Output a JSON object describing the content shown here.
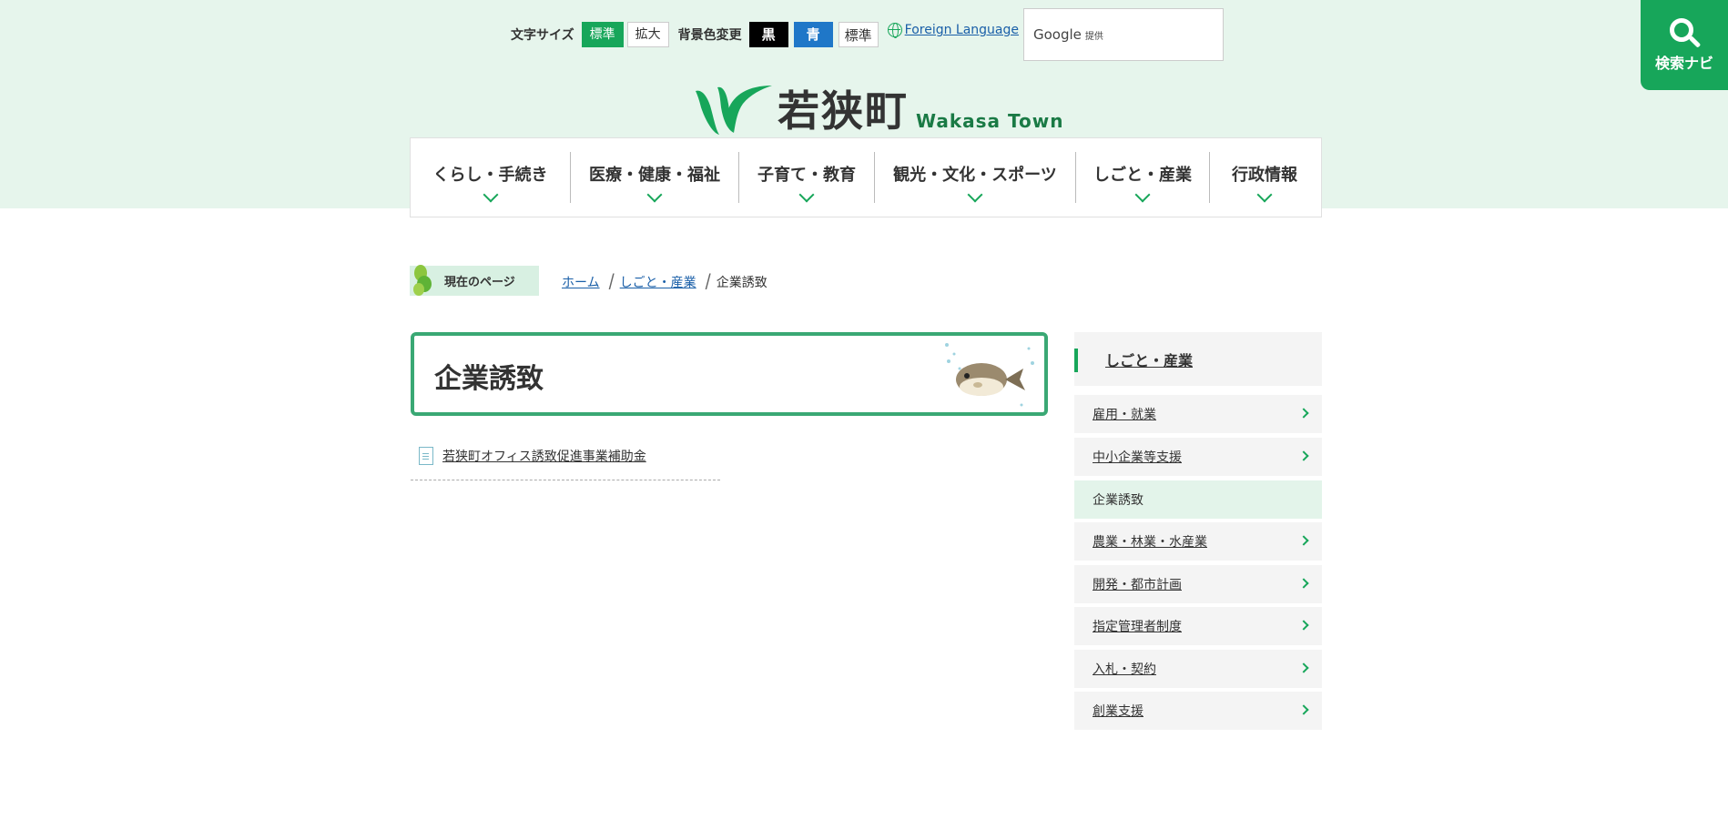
{
  "util": {
    "font_size_label": "文字サイズ",
    "font_size_standard": "標準",
    "font_size_large": "拡大",
    "bg_label": "背景色変更",
    "bg_black": "黒",
    "bg_blue": "青",
    "bg_standard": "標準",
    "foreign_language": "Foreign Language"
  },
  "search": {
    "google_label": "Google",
    "provided": "提供"
  },
  "search_navi": {
    "label": "検索ナビ"
  },
  "logo": {
    "name": "若狭町",
    "english": "Wakasa Town"
  },
  "gnav": [
    {
      "label": "くらし・手続き"
    },
    {
      "label": "医療・健康・福祉"
    },
    {
      "label": "子育て・教育"
    },
    {
      "label": "観光・文化・スポーツ"
    },
    {
      "label": "しごと・産業"
    },
    {
      "label": "行政情報"
    }
  ],
  "breadcrumb": {
    "tag": "現在のページ",
    "home": "ホーム",
    "parent": "しごと・産業",
    "current": "企業誘致"
  },
  "main": {
    "title": "企業誘致",
    "links": [
      "若狭町オフィス誘致促進事業補助金"
    ]
  },
  "side": {
    "heading": "しごと・産業",
    "items": [
      {
        "label": "雇用・就業"
      },
      {
        "label": "中小企業等支援"
      },
      {
        "label": "企業誘致"
      },
      {
        "label": "農業・林業・水産業"
      },
      {
        "label": "開発・都市計画"
      },
      {
        "label": "指定管理者制度"
      },
      {
        "label": "入札・契約"
      },
      {
        "label": "創業支援"
      }
    ]
  },
  "colors": {
    "accent": "#17a65a",
    "header_bg": "#e6f5ec",
    "title_border": "#3aa874",
    "link": "#1a5fa8"
  }
}
